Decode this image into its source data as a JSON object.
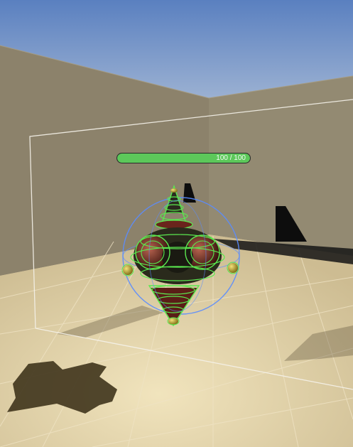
{
  "scene": {
    "name": "3d-viewport",
    "colors": {
      "sky_top": "#5e83c2",
      "sky_bottom": "#b6c6dc",
      "wall": "#918770",
      "wall_dark": "#837a64",
      "floor": "#d9c9a2",
      "floor_light": "#eadcb4",
      "grid": "#efe4c8",
      "shadow": "#1c1608",
      "gizmo_green": "#5be84f",
      "gizmo_blue": "#5a8cff",
      "body_red": "#7a2a22",
      "body_yellow": "#d8c03a"
    }
  },
  "health": {
    "current": 100,
    "max": 100,
    "text": "100 / 100",
    "color": "#5cc85a"
  }
}
